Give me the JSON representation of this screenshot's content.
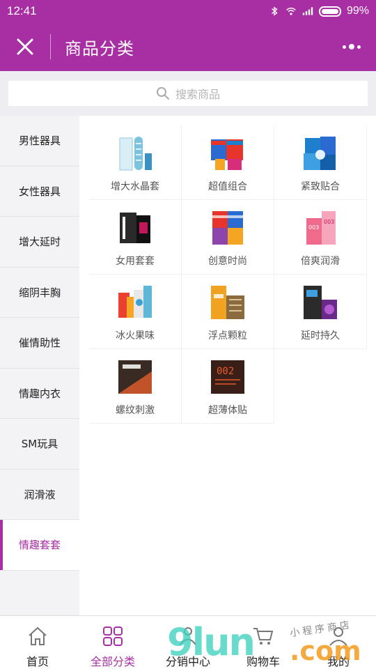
{
  "status": {
    "time": "12:41",
    "battery": "99%"
  },
  "header": {
    "title": "商品分类"
  },
  "search": {
    "placeholder": "搜索商品"
  },
  "sidebar": {
    "items": [
      {
        "label": "男性器具",
        "active": false
      },
      {
        "label": "女性器具",
        "active": false
      },
      {
        "label": "增大延时",
        "active": false
      },
      {
        "label": "缩阴丰胸",
        "active": false
      },
      {
        "label": "催情助性",
        "active": false
      },
      {
        "label": "情趣内衣",
        "active": false
      },
      {
        "label": "SM玩具",
        "active": false
      },
      {
        "label": "润滑液",
        "active": false
      },
      {
        "label": "情趣套套",
        "active": true
      }
    ]
  },
  "products": [
    {
      "label": "增大水晶套",
      "color": "#5fb7d8"
    },
    {
      "label": "超值组合",
      "color": "#e8352b"
    },
    {
      "label": "紧致贴合",
      "color": "#1f7fcf"
    },
    {
      "label": "女用套套",
      "color": "#2a2a2a"
    },
    {
      "label": "创意时尚",
      "color": "#e8352b"
    },
    {
      "label": "倍爽润滑",
      "color": "#f06a8c"
    },
    {
      "label": "冰火果味",
      "color": "#e9402f"
    },
    {
      "label": "浮点颗粒",
      "color": "#f0a321"
    },
    {
      "label": "延时持久",
      "color": "#2b2b2b"
    },
    {
      "label": "螺纹刺激",
      "color": "#b4481f"
    },
    {
      "label": "超薄体贴",
      "color": "#3a1f18"
    }
  ],
  "tabbar": {
    "items": [
      {
        "label": "首页",
        "icon": "home-icon",
        "active": false
      },
      {
        "label": "全部分类",
        "icon": "grid-icon",
        "active": true
      },
      {
        "label": "分销中心",
        "icon": "distribution-icon",
        "active": false
      },
      {
        "label": "购物车",
        "icon": "cart-icon",
        "active": false
      },
      {
        "label": "我的",
        "icon": "user-icon",
        "active": false
      }
    ]
  },
  "watermark": {
    "brand": "9lun",
    "domain": ".com",
    "tagline": "小程序商店"
  },
  "colors": {
    "accent": "#a72fa3",
    "background": "#f3f3f5"
  }
}
